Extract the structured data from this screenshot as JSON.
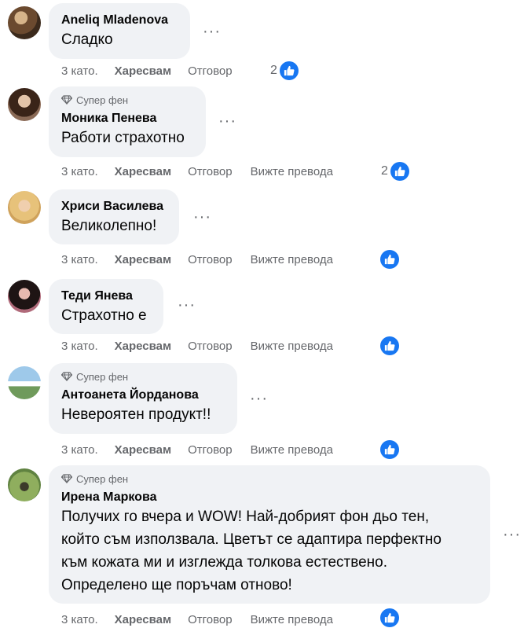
{
  "ui": {
    "like_label": "Харесвам",
    "reply_label": "Отговор",
    "translate_label": "Вижте превода",
    "more_label": "···",
    "super_fan_label": "Супер фен"
  },
  "comments": [
    {
      "author": "Aneliq Mladenova",
      "text": "Сладко",
      "time": "3 като.",
      "reactions": "2",
      "super_fan": false,
      "has_translate": false
    },
    {
      "author": "Моника Пенева",
      "text": "Работи страхотно",
      "time": "3 като.",
      "reactions": "2",
      "super_fan": true,
      "has_translate": true
    },
    {
      "author": "Хриси Василева",
      "text": "Великолепно!",
      "time": "3 като.",
      "reactions": "",
      "super_fan": false,
      "has_translate": true
    },
    {
      "author": "Теди Янева",
      "text": "Страхотно е",
      "time": "3 като.",
      "reactions": "",
      "super_fan": false,
      "has_translate": true
    },
    {
      "author": "Антоанета Йорданова",
      "text": "Невероятен продукт!!",
      "time": "3 като.",
      "reactions": "",
      "super_fan": true,
      "has_translate": true
    },
    {
      "author": "Ирена Маркова",
      "text_lines": [
        "Получих го вчера и WOW! Най-добрият фон дьо тен,",
        "който съм използвала. Цветът се адаптира перфектно",
        "към кожата ми и изглежда толкова естествено.",
        "Определено ще поръчам отново!"
      ],
      "time": "3 като.",
      "reactions": "",
      "super_fan": true,
      "has_translate": true
    }
  ],
  "colors": {
    "bubble": "#f0f2f5",
    "meta_text": "#65676b",
    "like_blue": "#1877f2"
  }
}
